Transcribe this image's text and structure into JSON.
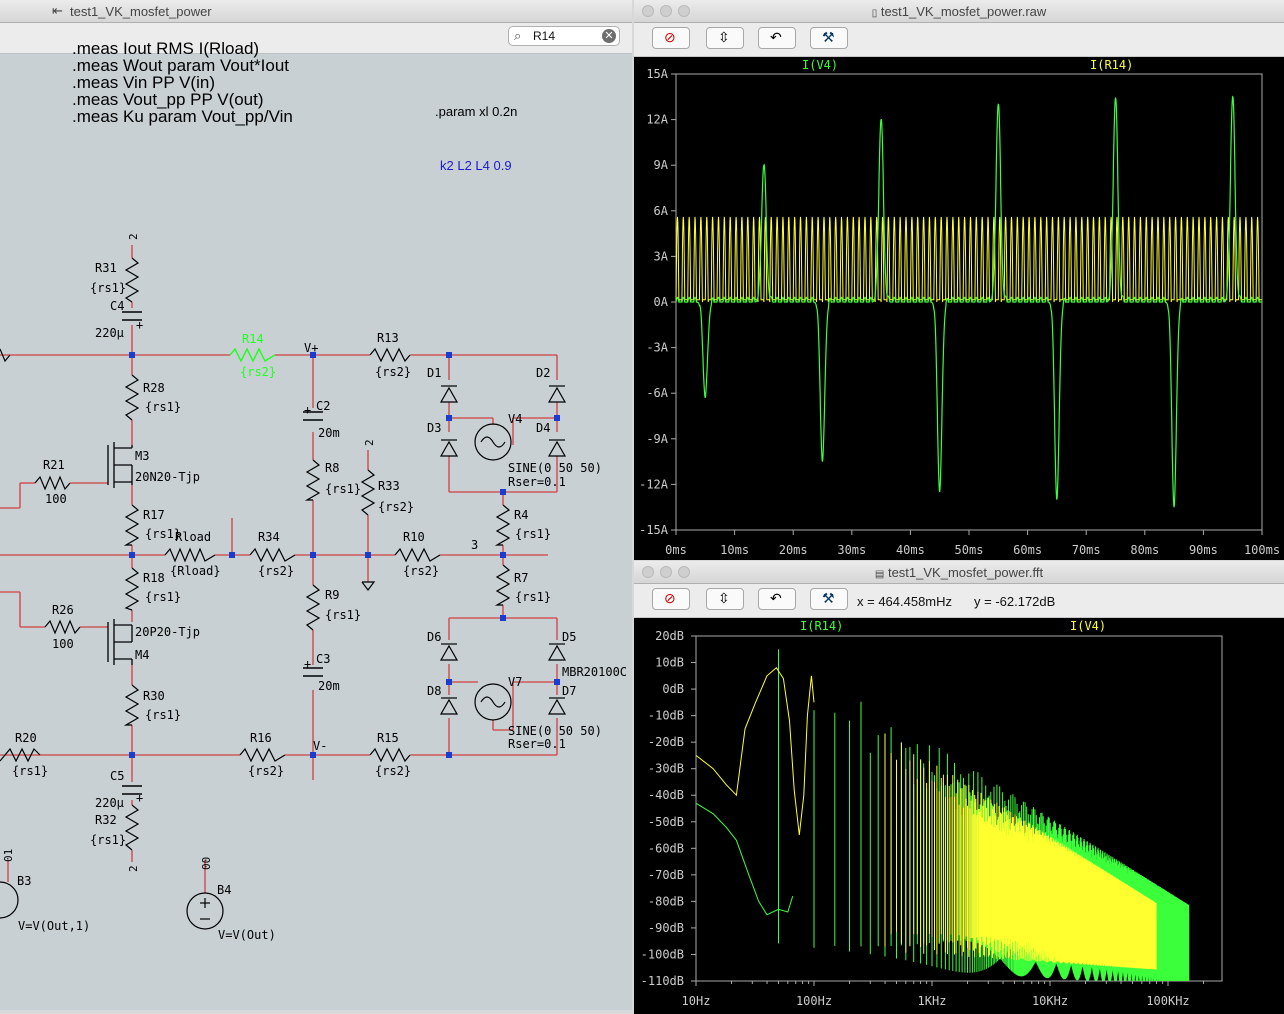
{
  "colors": {
    "sch_bg": "#c8d0d4",
    "wire": "#d04040",
    "junction": "#1a3cd0",
    "trace_green": "#3cff3c",
    "trace_yellow": "#ffff30",
    "sel": "#20ff20"
  },
  "schematic": {
    "title": "test1_VK_mosfet_power",
    "search_value": "R14",
    "directives": [
      ".meas Iout RMS I(Rload)",
      ".meas Wout param Vout*Iout",
      ".meas Vin PP V(in)",
      ".meas Vout_pp PP V(out)",
      ".meas Ku param Vout_pp/Vin"
    ],
    "param_text": ".param xl  0.2n",
    "k_text": "k2 L2 L4 0.9"
  },
  "raw": {
    "title": "test1_VK_mosfet_power.raw",
    "trace1": "I(V4)",
    "trace2": "I(R14)",
    "yticks": [
      "15A",
      "12A",
      "9A",
      "6A",
      "3A",
      "0A",
      "-3A",
      "-6A",
      "-9A",
      "-12A",
      "-15A"
    ],
    "xticks": [
      "0ms",
      "10ms",
      "20ms",
      "30ms",
      "40ms",
      "50ms",
      "60ms",
      "70ms",
      "80ms",
      "90ms",
      "100ms"
    ]
  },
  "fft": {
    "title": "test1_VK_mosfet_power.fft",
    "readout_x": "x = 464.458mHz",
    "readout_y": "y = -62.172dB",
    "trace1": "I(R14)",
    "trace2": "I(V4)",
    "yticks": [
      "20dB",
      "10dB",
      "0dB",
      "-10dB",
      "-20dB",
      "-30dB",
      "-40dB",
      "-50dB",
      "-60dB",
      "-70dB",
      "-80dB",
      "-90dB",
      "-100dB",
      "-110dB"
    ],
    "xticks": [
      "10Hz",
      "100Hz",
      "1KHz",
      "10KHz",
      "100KHz"
    ]
  },
  "chart_data": [
    {
      "type": "line",
      "title": "",
      "xlabel": "",
      "ylabel": "",
      "xlim": [
        0,
        100
      ],
      "ylim": [
        -15,
        15
      ],
      "series": [
        {
          "name": "I(V4)",
          "description_pts": [
            [
              5,
              -6.3
            ],
            [
              15,
              9
            ],
            [
              25,
              -10.5
            ],
            [
              35,
              12
            ],
            [
              45,
              -12.5
            ],
            [
              55,
              13
            ],
            [
              65,
              -13
            ],
            [
              75,
              13.4
            ],
            [
              85,
              -13.5
            ],
            [
              95,
              13.5
            ]
          ]
        },
        {
          "name": "I(R14)",
          "values_range": [
            0,
            5.6
          ],
          "period_ms": 1
        }
      ]
    },
    {
      "type": "line",
      "title": "",
      "xlabel": "",
      "ylabel": "",
      "xlim": [
        "10Hz",
        "200KHz"
      ],
      "ylim": [
        -110,
        20
      ],
      "series": [
        {
          "name": "I(R14)"
        },
        {
          "name": "I(V4)"
        }
      ]
    }
  ]
}
